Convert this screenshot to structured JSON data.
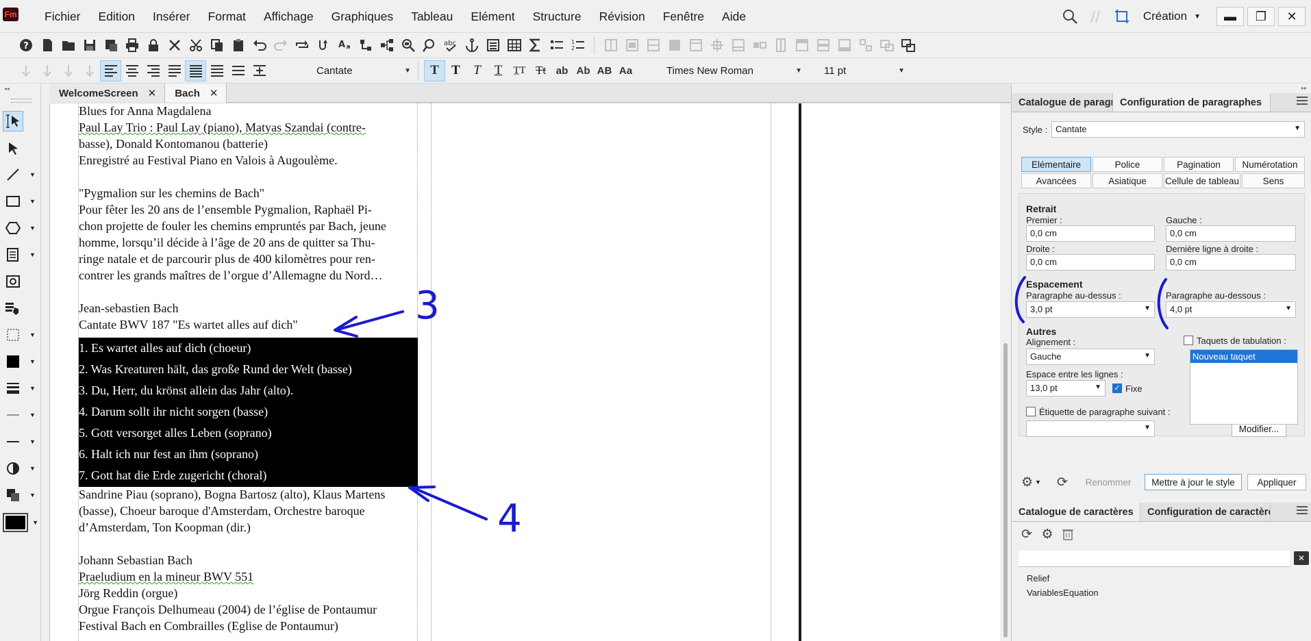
{
  "app": {
    "logo": "Fm"
  },
  "menu": [
    "Fichier",
    "Edition",
    "Insérer",
    "Format",
    "Affichage",
    "Graphiques",
    "Tableau",
    "Elément",
    "Structure",
    "Révision",
    "Fenêtre",
    "Aide"
  ],
  "workspace": {
    "label": "Création"
  },
  "format_bar": {
    "paragraph_style": "Cantate",
    "font": "Times New Roman",
    "size": "11 pt",
    "format_buttons": [
      "T",
      "T",
      "T",
      "T",
      "T̲T",
      "Tt",
      "ab",
      "Ab",
      "AB",
      "Aa"
    ]
  },
  "tabs": [
    {
      "label": "WelcomeScreen"
    },
    {
      "label": "Bach"
    }
  ],
  "document": {
    "lines_top": [
      "Blues for Anna Magdalena",
      "Paul Lay  Trio : Paul Lay (piano), Matyas Szandai (contre-",
      "basse), Donald Kontomanou (batterie)",
      "Enregistré au Festival Piano en Valois à Augoulème.",
      "",
      "\"Pygmalion sur les chemins de Bach\"",
      "Pour fêter les 20 ans de l’ensemble Pygmalion, Raphaël Pi-",
      "chon projette de fouler les chemins empruntés par Bach, jeune",
      "homme, lorsqu’il décide à l’âge de 20 ans de quitter sa Thu-",
      "ringe natale et de parcourir plus de 400 kilomètres pour ren-",
      "contrer les grands maîtres de l’orgue d’Allemagne du Nord…",
      "",
      "Jean-sebastien Bach",
      "Cantate BWV 187 \"Es wartet alles auf dich\""
    ],
    "lines_selected": [
      "1. Es wartet alles auf dich (choeur)",
      "2. Was Kreaturen hält, das große Rund der Welt (basse)",
      "3. Du, Herr, du krönst allein das Jahr (alto).",
      "4. Darum sollt ihr nicht sorgen (basse)",
      "5. Gott versorget alles Leben (soprano)",
      "6. Halt ich nur fest an ihm (soprano)",
      "7. Gott hat die Erde zugericht (choral)"
    ],
    "lines_bottom": [
      "Sandrine Piau (soprano), Bogna Bartosz (alto), Klaus Martens",
      "(basse), Choeur baroque d'Amsterdam, Orchestre baroque",
      "d’Amsterdam, Ton Koopman (dir.)",
      "",
      "Johann Sebastian Bach",
      "Praeludium en la mineur BWV 551",
      "Jörg Reddin (orgue)",
      "Orgue François Delhumeau (2004) de l’église de Pontaumur",
      "Festival Bach en Combrailles (Eglise de Pontaumur)"
    ]
  },
  "annotations": {
    "label_3": "3",
    "label_4": "4"
  },
  "para_panel": {
    "tabs": [
      "Catalogue de paragr",
      "Configuration de paragraphes"
    ],
    "style_label": "Style :",
    "style_value": "Cantate",
    "property_tabs_row1": [
      "Elémentaire",
      "Police",
      "Pagination",
      "Numérotation"
    ],
    "property_tabs_row2": [
      "Avancées",
      "Asiatique",
      "Cellule de tableau",
      "Sens"
    ],
    "retrait": {
      "title": "Retrait",
      "premier_label": "Premier :",
      "premier": "0,0 cm",
      "gauche_label": "Gauche :",
      "gauche": "0,0 cm",
      "droite_label": "Droite :",
      "droite": "0,0 cm",
      "derniere_label": "Dernière ligne à droite :",
      "derniere": "0,0 cm"
    },
    "espacement": {
      "title": "Espacement",
      "dessus_label": "Paragraphe au-dessus :",
      "dessus": "3,0 pt",
      "dessous_label": "Paragraphe au-dessous :",
      "dessous": "4,0 pt"
    },
    "autres": {
      "title": "Autres",
      "alignement_label": "Alignement :",
      "alignement": "Gauche",
      "taquets_label": "Taquets de tabulation :",
      "taquet_item": "Nouveau taquet",
      "interligne_label": "Espace entre les lignes :",
      "interligne": "13,0 pt",
      "fixe_label": "Fixe",
      "etiquette_label": "Étiquette de paragraphe suivant :",
      "etiquette": "",
      "modifier": "Modifier..."
    },
    "footer": {
      "renommer": "Renommer",
      "maj": "Mettre à jour le style",
      "appliquer": "Appliquer"
    }
  },
  "char_panel": {
    "tabs": [
      "Catalogue de caractères",
      "Configuration de caractère"
    ],
    "search": "",
    "items": [
      "Relief",
      "VariablesEquation"
    ]
  },
  "colors": {
    "accent": "#1f75d6",
    "annotation_ink": "#1a1ad0",
    "selection": "#000000"
  }
}
